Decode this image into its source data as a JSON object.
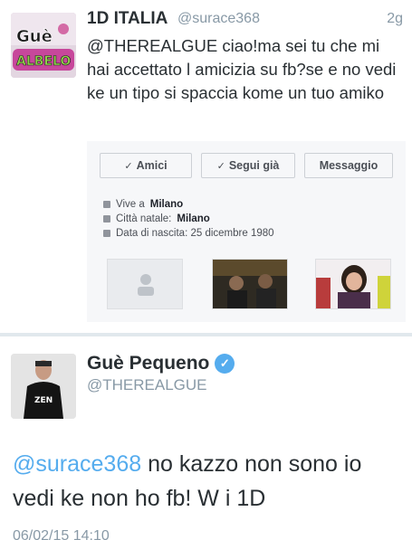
{
  "tweet1": {
    "display_name": "1D ITALIA",
    "handle": "@surace368",
    "time": "2g",
    "text": "@THEREALGUE ciao!ma sei tu che mi hai accettato l amicizia su fb?se e no vedi ke un tipo si spaccia kome un tuo amiko",
    "avatar_text": "Guè ALBELO",
    "facebook_card": {
      "buttons": [
        {
          "label": "Amici",
          "icon": "check-icon"
        },
        {
          "label": "Segui già",
          "icon": "check-icon"
        },
        {
          "label": "Messaggio",
          "icon": ""
        }
      ],
      "info": [
        {
          "prefix": "Vive a",
          "value": "Milano",
          "icon": "home-icon"
        },
        {
          "prefix": "Città natale:",
          "value": "Milano",
          "icon": "pin-icon"
        },
        {
          "prefix": "Data di nascita: 25 dicembre 1980",
          "value": "",
          "icon": "calendar-icon"
        }
      ]
    }
  },
  "tweet2": {
    "display_name": "Guè Pequeno",
    "handle": "@THEREALGUE",
    "mention": "@surace368",
    "text": " no kazzo non sono io vedi ke non ho fb! W i 1D",
    "date": "06/02/15 14:10",
    "avatar_shirt_text": "ZEN",
    "verified_badge": "verified-icon"
  },
  "colors": {
    "link": "#55acee",
    "secondary_text": "#8899a6",
    "primary_text": "#292f33"
  }
}
